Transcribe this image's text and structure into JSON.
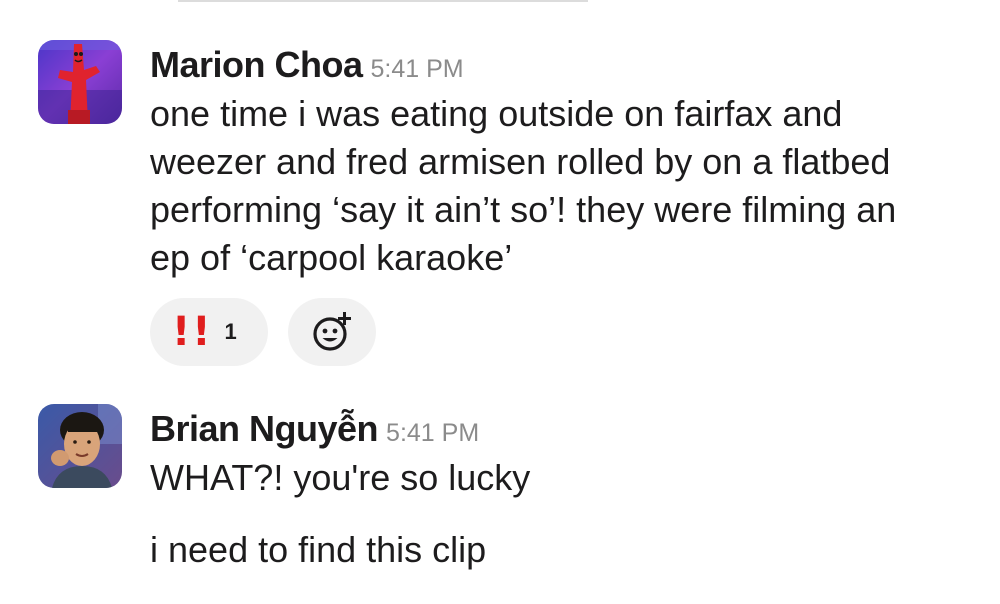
{
  "messages": [
    {
      "author": "Marion Choa",
      "time": "5:41 PM",
      "avatar": "inflatable-tube-man-avatar",
      "text": "one time i was eating outside on fairfax and\nweezer and fred armisen rolled by on a flatbed\nperforming ‘say it ain’t so’! they were filming an\nep of ‘carpool karaoke’",
      "reactions": [
        {
          "emoji": "!!",
          "icon": "double-exclamation-icon",
          "count": "1"
        }
      ],
      "add_reaction_icon": "add-reaction-icon"
    },
    {
      "author": "Brian Nguyễn",
      "time": "5:41 PM",
      "avatar": "person-photo-avatar",
      "lines": [
        "WHAT?! you're so lucky",
        "i need to find this clip"
      ]
    }
  ],
  "colors": {
    "text": "#1d1c1d",
    "timestamp": "#8b8b8b",
    "reaction_bg": "#f1f1f1",
    "emoji_red": "#e01e1e"
  }
}
